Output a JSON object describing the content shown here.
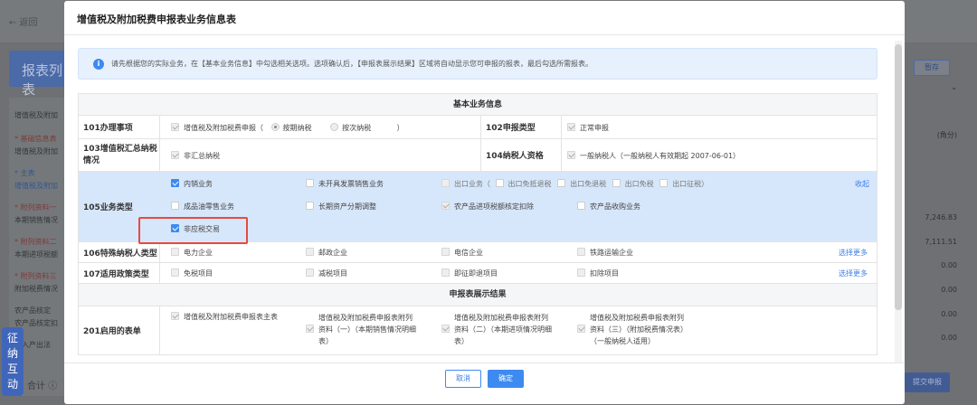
{
  "background": {
    "back_label": "← 返回",
    "banner": "报表列表",
    "sidebar": [
      {
        "text": "增值税及附加",
        "style": "normal"
      },
      {
        "text": "* 基础信息表",
        "style": "red"
      },
      {
        "text": "增值税及附加",
        "style": "normal"
      },
      {
        "text": "* 主表",
        "style": "blue"
      },
      {
        "text": "增值税及附加",
        "style": "blue"
      },
      {
        "text": "* 附列资料一",
        "style": "red"
      },
      {
        "text": "本期销售情况",
        "style": "normal"
      },
      {
        "text": "* 附列资料二",
        "style": "red"
      },
      {
        "text": "本期进项税额",
        "style": "normal"
      },
      {
        "text": "* 附列资料三",
        "style": "red"
      },
      {
        "text": "附加税费情况",
        "style": "normal"
      },
      {
        "text": "农产品核定",
        "style": "normal"
      },
      {
        "text": "农产品核定扣",
        "style": "normal"
      },
      {
        "text": "投入产出法",
        "style": "normal"
      }
    ],
    "save": "暂存",
    "unit": "(角分)",
    "right_values": [
      "7,246.83",
      "7,111.51",
      "0.00",
      "0.00",
      "0.00",
      "0.00"
    ],
    "submit": "提交申报",
    "total": "合计 ⓘ",
    "chat": [
      "征",
      "纳",
      "互",
      "动"
    ]
  },
  "modal": {
    "title": "增值税及附加税费申报表业务信息表",
    "notice": "请先根据您的实际业务，在【基本业务信息】中勾选相关选项。选项确认后，【申报表展示结果】区域将自动显示您可申报的报表，最后勾选所需报表。",
    "section_basic": "基本业务信息",
    "r101": {
      "label": "101办理事项",
      "item": "增值税及附加税费申报（",
      "radio1": "按期纳税",
      "radio2": "按次纳税",
      "close": "）"
    },
    "r102": {
      "label": "102申报类型",
      "item": "正常申报"
    },
    "r103": {
      "label": "103增值税汇总纳税情况",
      "item": "非汇总纳税"
    },
    "r104": {
      "label": "104纳税人资格",
      "item": "一般纳税人（一般纳税人有效期起 2007-06-01）"
    },
    "r105": {
      "label": "105业务类型",
      "neixiao": "内销业务",
      "weikai": "未开具发票销售业务",
      "chukou": "出口业务（",
      "chukou1": "出口免抵退税",
      "chukou2": "出口免退税",
      "chukou3": "出口免税",
      "chukou4": "出口征税）",
      "shouqi": "收起",
      "chengpin": "成品油零售业务",
      "changqi": "长期资产分期调整",
      "nongchanpin": "农产品进项税额核定扣除",
      "nongshougou": "农产品收购业务",
      "feiyingshui": "非应税交易"
    },
    "r106": {
      "label": "106特殊纳税人类型",
      "items": [
        "电力企业",
        "邮政企业",
        "电信企业",
        "铁路运输企业"
      ],
      "more": "选择更多"
    },
    "r107": {
      "label": "107适用政策类型",
      "items": [
        "免税项目",
        "减税项目",
        "即征即退项目",
        "扣除项目"
      ],
      "more": "选择更多"
    },
    "section_result": "申报表展示结果",
    "r201": {
      "label": "201启用的表单",
      "main": "增值税及附加税费申报表主表",
      "f1a": "增值税及附加税费申报表附列",
      "f1b": "资料（一）（本期销售情况明细",
      "f1c": "表）",
      "f2a": "增值税及附加税费申报表附列",
      "f2b": "资料（二）（本期进项情况明细",
      "f2c": "表）",
      "f3a": "增值税及附加税费申报表附列",
      "f3b": "资料（三）（附加税费情况表）",
      "f3c": "（一般纳税人适用）"
    },
    "cancel": "取消",
    "ok": "确定"
  }
}
